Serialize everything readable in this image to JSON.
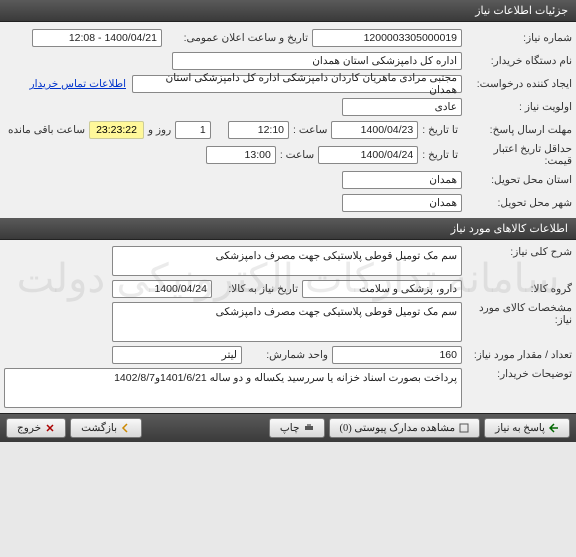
{
  "window_title": "جزئیات اطلاعات نیاز",
  "section1": {
    "need_number_label": "شماره نیاز:",
    "need_number": "1200003305000019",
    "announce_datetime_label": "تاریخ و ساعت اعلان عمومی:",
    "announce_datetime": "1400/04/21 - 12:08",
    "buyer_org_label": "نام دستگاه خریدار:",
    "buyer_org": "اداره کل دامپزشکی استان همدان",
    "requester_label": "ایجاد کننده درخواست:",
    "requester": "مجتبی مرادی ماهریان کاردان دامپزشکی اداره کل دامپزشکی استان همدان",
    "contact_link": "اطلاعات تماس خریدار",
    "priority_label": "اولویت نیاز :",
    "priority": "عادی",
    "deadline_label": "مهلت ارسال پاسخ:",
    "to_date_label": "تا تاریخ :",
    "deadline_date": "1400/04/23",
    "time_label": "ساعت :",
    "deadline_time": "12:10",
    "days_count": "1",
    "days_and": "روز و",
    "remaining_time": "23:23:22",
    "remaining_suffix": "ساعت باقی مانده",
    "price_validity_label": "حداقل تاریخ اعتبار قیمت:",
    "to_date_label2": "تا تاریخ :",
    "price_date": "1400/04/24",
    "price_time": "13:00",
    "delivery_province_label": "استان محل تحویل:",
    "delivery_province": "همدان",
    "delivery_city_label": "شهر محل تحویل:",
    "delivery_city": "همدان"
  },
  "section2_title": "اطلاعات کالاهای مورد نیاز",
  "section2": {
    "need_desc_label": "شرح کلی نیاز:",
    "need_desc": "سم مک تومیل قوطی پلاستیکی جهت مصرف دامپزشکی",
    "goods_group_label": "گروه کالا:",
    "goods_group": "دارو، پزشکی و سلامت",
    "need_to_goods_label": "تاریخ نیاز به کالا:",
    "need_to_goods_date": "1400/04/24",
    "goods_spec_label": "مشخصات کالای مورد نیاز:",
    "goods_spec": "سم مک تومیل قوطی پلاستیکی جهت مصرف دامپزشکی",
    "qty_label": "تعداد / مقدار مورد نیاز:",
    "qty": "160",
    "unit_label": "واحد شمارش:",
    "unit": "لیتر",
    "buyer_notes_label": "توضیحات خریدار:",
    "buyer_notes": "پرداخت بصورت اسناد خزانه یا سررسید یکساله و دو ساله 1401/6/21و1402/8/7"
  },
  "footer": {
    "respond": "پاسخ به نیاز",
    "attachments": "مشاهده مدارک پیوستی (0)",
    "print": "چاپ",
    "back": "بازگشت",
    "exit": "خروج"
  },
  "watermark": "سامانه تدارکات الکترونیکی دولت"
}
